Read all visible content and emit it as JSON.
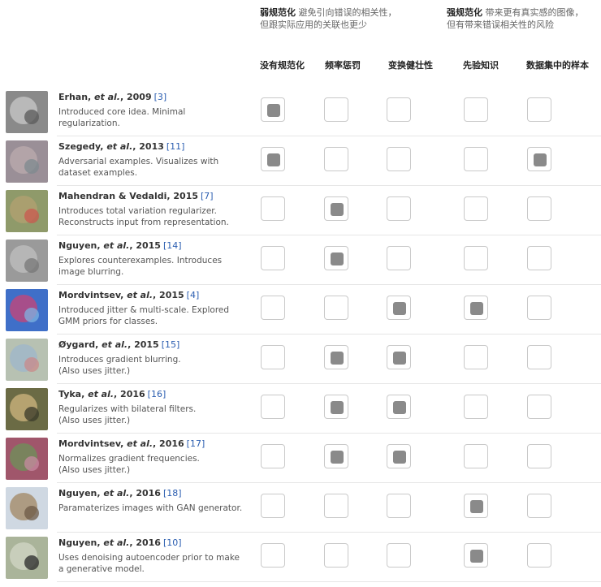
{
  "spectrum": {
    "weak": {
      "bold": "弱规范化",
      "text1": " 避免引向错误的相关性，",
      "text2": "但跟实际应用的关联也更少"
    },
    "strong": {
      "bold": "强规范化",
      "text1": " 带来更有真实感的图像，",
      "text2": "但有带来错误相关性的风险"
    }
  },
  "columns": [
    {
      "label": "没有规范化"
    },
    {
      "label": "频率惩罚"
    },
    {
      "label": "变换健壮性"
    },
    {
      "label": "先验知识"
    },
    {
      "label": "数据集中的样本"
    }
  ],
  "rows": [
    {
      "author": "Erhan, ",
      "etal": "et al.",
      "year": ", 2009",
      "ref": "[3]",
      "line1": "Introduced core idea. Minimal",
      "line2": "regularization.",
      "checks": [
        true,
        false,
        false,
        false,
        false
      ],
      "thumb_colors": [
        "#8a8a8a",
        "#c4c4c4",
        "#5a5a5a"
      ]
    },
    {
      "author": "Szegedy, ",
      "etal": "et al.",
      "year": ", 2013",
      "ref": "[11]",
      "line1": "Adversarial examples. Visualizes with",
      "line2": "dataset examples.",
      "checks": [
        true,
        false,
        false,
        false,
        true
      ],
      "thumb_colors": [
        "#9a8f97",
        "#b9a9ad",
        "#7d8a8f"
      ]
    },
    {
      "author": "Mahendran & Vedaldi, 2015",
      "etal": "",
      "year": "",
      "ref": "[7]",
      "line1": "Introduces total variation regularizer.",
      "line2": "Reconstructs input from representation.",
      "checks": [
        false,
        true,
        false,
        false,
        false
      ],
      "thumb_colors": [
        "#8f9a6a",
        "#b0a070",
        "#c9584f"
      ]
    },
    {
      "author": "Nguyen, ",
      "etal": "et al.",
      "year": ", 2015",
      "ref": "[14]",
      "line1": "Explores counterexamples. Introduces",
      "line2": "image blurring.",
      "checks": [
        false,
        true,
        false,
        false,
        false
      ],
      "thumb_colors": [
        "#9a9a9a",
        "#bdbdbd",
        "#777777"
      ]
    },
    {
      "author": "Mordvintsev, ",
      "etal": "et al.",
      "year": ", 2015",
      "ref": "[4]",
      "line1": "Introduced jitter & multi-scale. Explored",
      "line2": "GMM priors for classes.",
      "checks": [
        false,
        false,
        true,
        true,
        false
      ],
      "thumb_colors": [
        "#3f6fc8",
        "#c2467a",
        "#7fb3e0"
      ]
    },
    {
      "author": "Øygard, ",
      "etal": "et al.",
      "year": ", 2015",
      "ref": "[15]",
      "line1": "Introduces gradient blurring.",
      "line2": "(Also uses jitter.)",
      "checks": [
        false,
        true,
        true,
        false,
        false
      ],
      "thumb_colors": [
        "#b7c1b2",
        "#9fb6c9",
        "#c98a8a"
      ]
    },
    {
      "author": "Tyka, ",
      "etal": "et al.",
      "year": ", 2016",
      "ref": "[16]",
      "line1": "Regularizes with bilateral filters.",
      "line2": "(Also uses jitter.)",
      "checks": [
        false,
        true,
        true,
        false,
        false
      ],
      "thumb_colors": [
        "#6b6b45",
        "#c9b27a",
        "#3a3a2a"
      ]
    },
    {
      "author": "Mordvintsev, ",
      "etal": "et al.",
      "year": ", 2016",
      "ref": "[17]",
      "line1": "Normalizes gradient frequencies.",
      "line2": "(Also uses jitter.)",
      "checks": [
        false,
        true,
        true,
        false,
        false
      ],
      "thumb_colors": [
        "#a0566b",
        "#6f8f5a",
        "#c78aa0"
      ]
    },
    {
      "author": "Nguyen, ",
      "etal": "et al.",
      "year": ", 2016",
      "ref": "[18]",
      "line1": "Paramaterizes images with GAN generator.",
      "line2": "",
      "checks": [
        false,
        false,
        false,
        true,
        false
      ],
      "thumb_colors": [
        "#cfd8e2",
        "#a48c6a",
        "#6d5a45"
      ]
    },
    {
      "author": "Nguyen, ",
      "etal": "et al.",
      "year": ", 2016",
      "ref": "[10]",
      "line1": "Uses denoising autoencoder prior to make",
      "line2": "a generative model.",
      "checks": [
        false,
        false,
        false,
        true,
        false
      ],
      "thumb_colors": [
        "#aab49a",
        "#cfd5c3",
        "#2a2a2a"
      ]
    }
  ]
}
